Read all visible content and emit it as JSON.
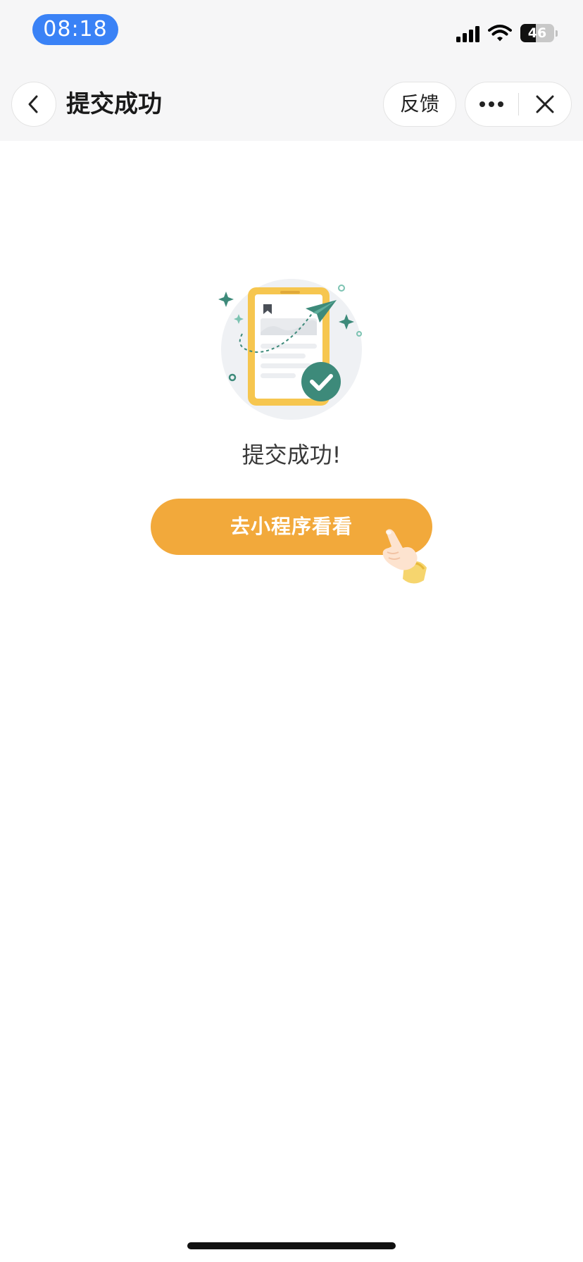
{
  "status_bar": {
    "time": "08:18",
    "battery": "46",
    "icons": [
      "signal-icon",
      "wifi-icon",
      "battery-icon"
    ]
  },
  "nav": {
    "title": "提交成功",
    "feedback_label": "反馈",
    "icons": [
      "back-icon",
      "more-icon",
      "close-icon"
    ]
  },
  "result": {
    "message": "提交成功!",
    "illustration": "document-sent-success-illustration"
  },
  "actions": {
    "open_miniprogram_label": "去小程序看看"
  },
  "colors": {
    "status_time_pill": "#3a82f6",
    "primary_button": "#f2a93b",
    "illustration_accent": "#3d8a7a",
    "document_frame": "#f6c64f",
    "header_background": "#f6f6f7"
  }
}
